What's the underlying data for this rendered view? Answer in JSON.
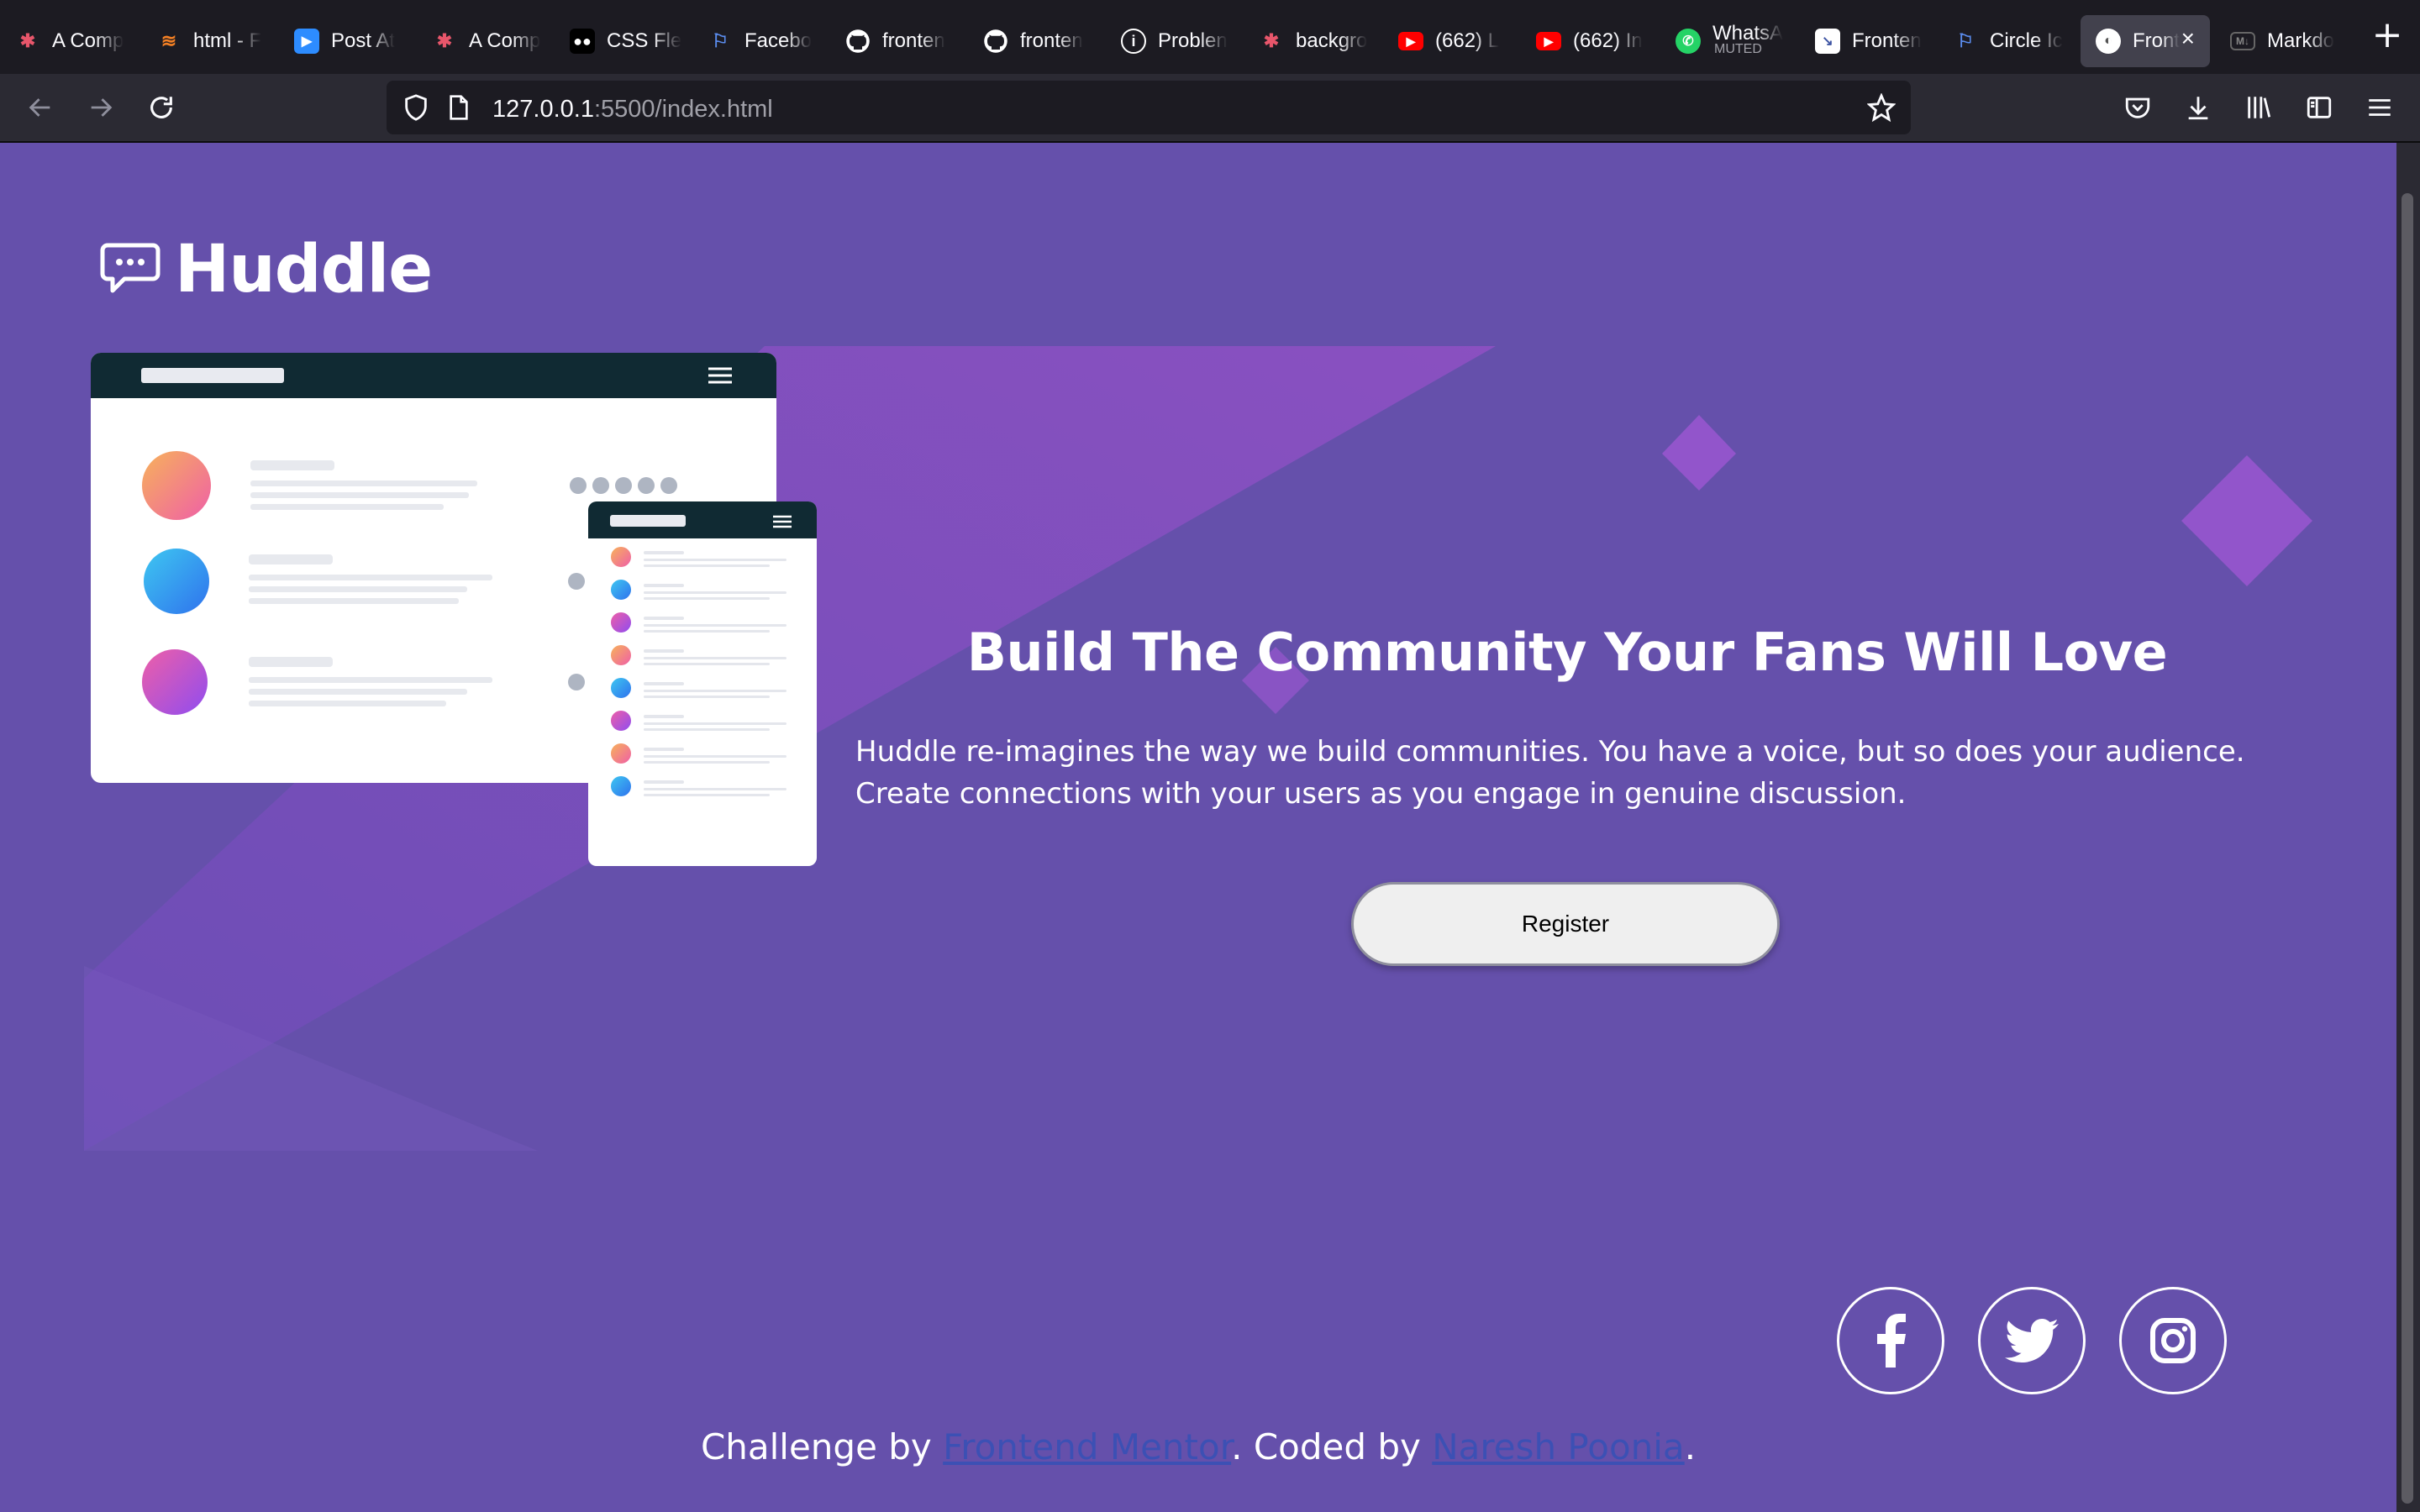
{
  "browser": {
    "tabs": [
      {
        "title": "A Comp",
        "icon": "asterisk-icon"
      },
      {
        "title": "html - F",
        "icon": "stackoverflow-icon"
      },
      {
        "title": "Post At",
        "icon": "zoom-icon"
      },
      {
        "title": "A Comp",
        "icon": "asterisk-icon"
      },
      {
        "title": "CSS Fle",
        "icon": "medium-icon"
      },
      {
        "title": "Facebo",
        "icon": "flag-icon"
      },
      {
        "title": "fronten",
        "icon": "github-icon"
      },
      {
        "title": "fronten",
        "icon": "github-icon"
      },
      {
        "title": "Problen",
        "icon": "info-icon"
      },
      {
        "title": "backgro",
        "icon": "asterisk-icon"
      },
      {
        "title": "(662) L",
        "icon": "youtube-icon"
      },
      {
        "title": "(662) In",
        "icon": "youtube-icon"
      },
      {
        "title": "WhatsA",
        "subtitle": "MUTED",
        "icon": "whatsapp-icon"
      },
      {
        "title": "Fronten",
        "icon": "frontendmentor-icon"
      },
      {
        "title": "Circle Ic",
        "icon": "flag-icon"
      },
      {
        "title": "Front",
        "icon": "globe-icon",
        "active": true
      },
      {
        "title": "Markdo",
        "icon": "markdown-icon"
      }
    ],
    "url": {
      "host": "127.0.0.1",
      "rest": ":5500/index.html"
    }
  },
  "page": {
    "logo": "Huddle",
    "headline": "Build The Community Your Fans Will Love",
    "description": "Huddle re-imagines the way we build communities. You have a voice, but so does your audience. Create connections with your users as you engage in genuine discussion.",
    "register_label": "Register",
    "social": [
      "facebook-icon",
      "twitter-icon",
      "instagram-icon"
    ],
    "footer": {
      "prefix": "Challenge by ",
      "link1": "Frontend Mentor",
      "middle": ". Coded by ",
      "link2": "Naresh Poonia",
      "suffix": "."
    }
  },
  "colors": {
    "page_bg": "#6550ab",
    "accent_violet": "#a157d6",
    "link": "#3c50b4"
  }
}
